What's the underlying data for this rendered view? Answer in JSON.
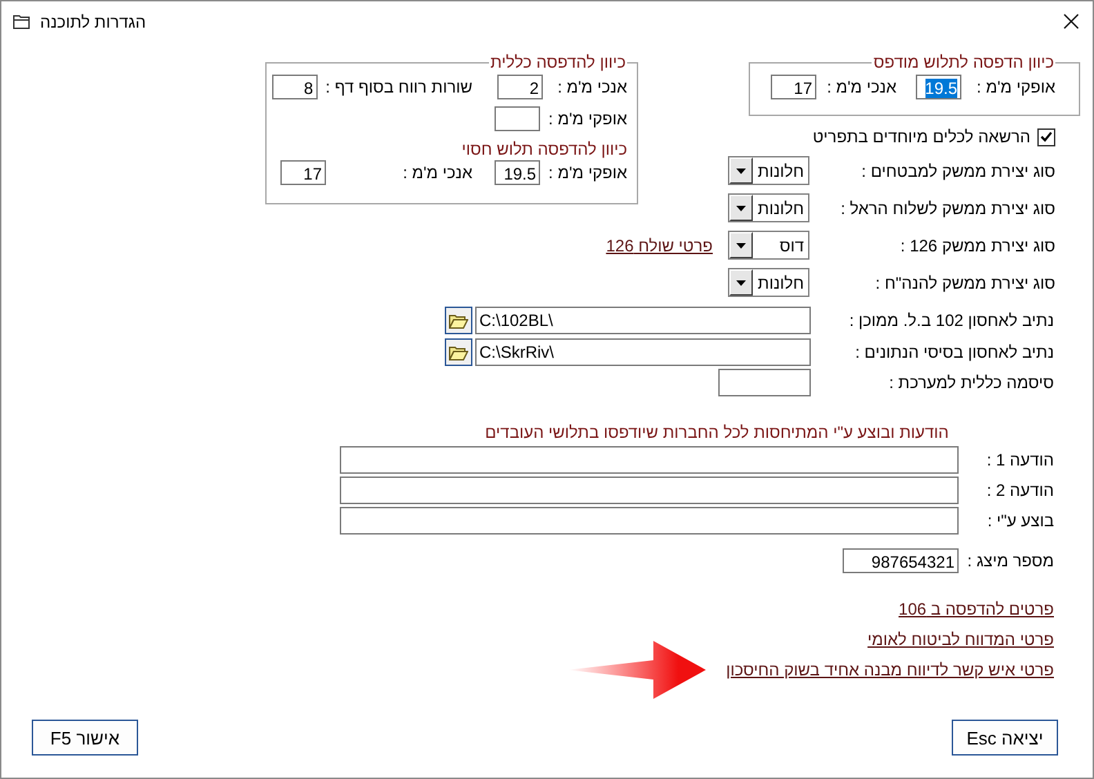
{
  "window": {
    "title": "הגדרות לתוכנה"
  },
  "general_print_offset": {
    "title": "כיוון להדפסה כללית",
    "fields": [
      {
        "label": "אנכי מ'מ :",
        "value": "2"
      },
      {
        "label": "שורות רווח בסוף דף :",
        "value": "8"
      },
      {
        "label": "אופקי מ'מ :"
      }
    ],
    "subtitle": "כיוון להדפסה תלוש חסוי",
    "sub_fields": [
      {
        "label": "אופקי מ'מ :",
        "value": "19.5"
      },
      {
        "label": "אנכי מ'מ :",
        "value": "17"
      }
    ]
  },
  "printed_slip_offset": {
    "title": "כיוון הדפסה לתלוש מודפס",
    "fields": [
      {
        "label": "אופקי מ'מ :",
        "value": "19.5",
        "selected": true
      },
      {
        "label": "אנכי מ'מ :",
        "value": "17",
        "selected": false
      }
    ]
  },
  "special_tools_checkbox": {
    "label": "הרשאה לכלים מיוחדים בתפריט",
    "checked": true
  },
  "interface_types": [
    {
      "label": "סוג יצירת ממשק למבטחים :",
      "value": "חלונות"
    },
    {
      "label": "סוג יצירת ממשק לשלוח הראל :",
      "value": "חלונות"
    },
    {
      "label": "סוג יצירת ממשק 126 :",
      "value": "דוס",
      "link": "פרטי שולח 126"
    },
    {
      "label": "סוג יצירת ממשק להנה\"ח :",
      "value": "חלונות"
    }
  ],
  "paths": [
    {
      "label": "נתיב לאחסון 102 ב.ל. ממוכן :",
      "value": "C:\\102BL\\"
    },
    {
      "label": "נתיב לאחסון בסיסי הנתונים :",
      "value": "C:\\SkrRiv\\"
    }
  ],
  "system_password": {
    "label": "סיסמה כללית למערכת :"
  },
  "messages": {
    "heading": "הודעות ובוצע ע\"י המתיחסות לכל החברות שיודפסו בתלושי העובדים",
    "fields": [
      {
        "label": "הודעה 1 :"
      },
      {
        "label": "הודעה 2 :"
      },
      {
        "label": "בוצע ע\"י :"
      }
    ]
  },
  "representative_number": {
    "label": "מספר מיצג :",
    "value": "987654321"
  },
  "links": [
    {
      "label": "פרטים להדפסה ב 106",
      "highlighted": false
    },
    {
      "label": "פרטי המדווח לביטוח לאומי",
      "highlighted": false
    },
    {
      "label": "פרטי איש קשר לדיווח מבנה אחיד בשוק החיסכון",
      "highlighted": true
    }
  ],
  "buttons": [
    {
      "label": "יציאה Esc",
      "kind": "exit"
    },
    {
      "label": "אישור F5",
      "kind": "ok"
    }
  ]
}
